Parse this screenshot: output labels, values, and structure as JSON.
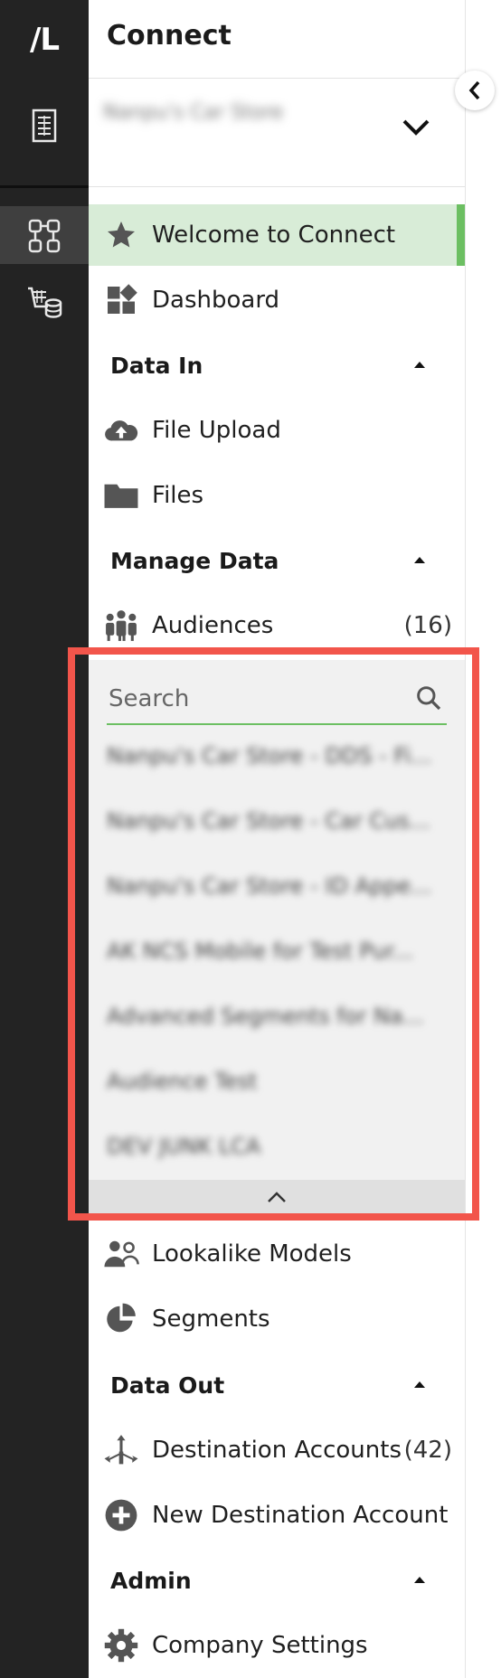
{
  "brand": {
    "logo_text": "/L"
  },
  "app": {
    "title": "Connect"
  },
  "store": {
    "name": "Nanpu's Car Store"
  },
  "nav": {
    "welcome": "Welcome to Connect",
    "dashboard": "Dashboard",
    "sections": {
      "data_in": "Data In",
      "manage_data": "Manage Data",
      "data_out": "Data Out",
      "admin": "Admin"
    },
    "file_upload": "File Upload",
    "files": "Files",
    "audiences": {
      "label": "Audiences",
      "count": "(16)"
    },
    "lookalike_models": "Lookalike Models",
    "segments": "Segments",
    "destination_accounts": {
      "label": "Destination Accounts",
      "count": "(42)"
    },
    "new_destination_account": "New Destination Account",
    "company_settings": "Company Settings"
  },
  "audience_search": {
    "placeholder": "Search",
    "items": [
      "Nanpu's Car Store - DDS - Fi...",
      "Nanpu's Car Store - Car Cus...",
      "Nanpu's Car Store - ID Appe...",
      "AK NCS Mobile for Test Pur...",
      "Advanced Segments for Na...",
      "Audience Test",
      "DEV JUNK LCA"
    ]
  },
  "colors": {
    "rail": "#232323",
    "active_bg": "#d8ecd7",
    "accent_green": "#6cbf62",
    "highlight_red": "#f2554b"
  }
}
